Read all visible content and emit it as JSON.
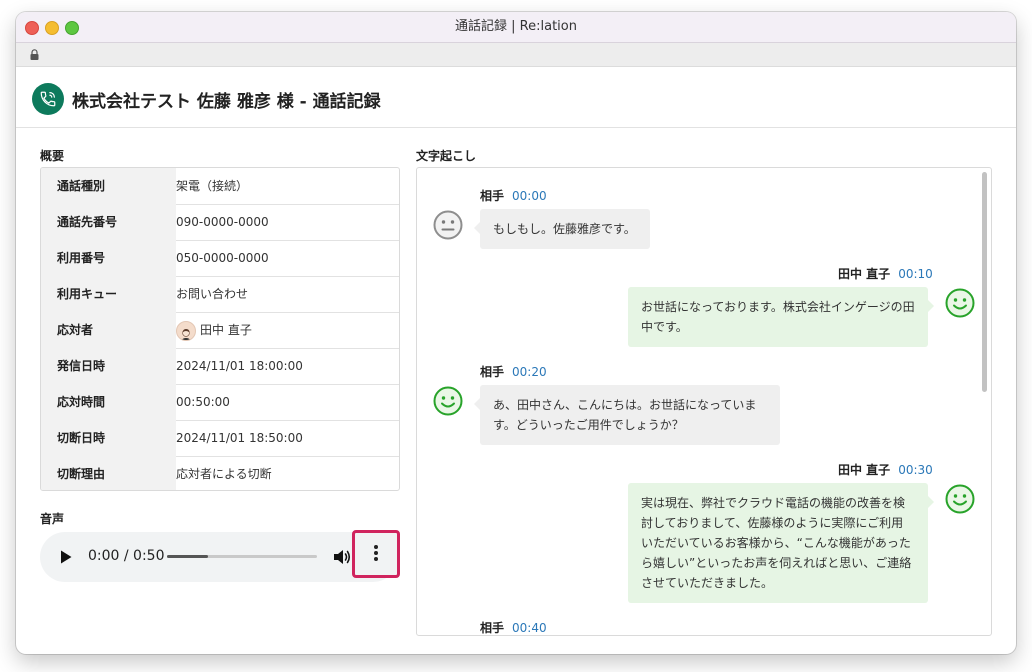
{
  "window": {
    "title": "通話記録 | Re:lation"
  },
  "header": {
    "title": "株式会社テスト  佐藤 雅彦  様 - 通話記録",
    "icon": "phone-icon",
    "accent": "#0d7a5c"
  },
  "summary": {
    "label": "概要",
    "rows": [
      {
        "key": "通話種別",
        "value": "架電（接続）"
      },
      {
        "key": "通話先番号",
        "value": "090-0000-0000"
      },
      {
        "key": "利用番号",
        "value": "050-0000-0000"
      },
      {
        "key": "利用キュー",
        "value": "お問い合わせ"
      },
      {
        "key": "応対者",
        "value": "田中 直子"
      },
      {
        "key": "発信日時",
        "value": "2024/11/01 18:00:00"
      },
      {
        "key": "応対時間",
        "value": "00:50:00"
      },
      {
        "key": "切断日時",
        "value": "2024/11/01 18:50:00"
      },
      {
        "key": "切断理由",
        "value": "応対者による切断"
      }
    ]
  },
  "audio": {
    "label": "音声",
    "time": "0:00 / 0:50",
    "progress_fraction": 0.27,
    "more_button_highlight": "#d0245e"
  },
  "transcript": {
    "label": "文字起こし",
    "messages": [
      {
        "speaker": "相手",
        "time": "00:00",
        "side": "other",
        "sentiment": "neutral-face-icon",
        "text": "もしもし。佐藤雅彦です。"
      },
      {
        "speaker": "田中 直子",
        "time": "00:10",
        "side": "me",
        "sentiment": "smile-face-icon",
        "text": "お世話になっております。株式会社インゲージの田中です。"
      },
      {
        "speaker": "相手",
        "time": "00:20",
        "side": "other",
        "sentiment": "smile-face-icon",
        "text": "あ、田中さん、こんにちは。お世話になっています。どういったご用件でしょうか？"
      },
      {
        "speaker": "田中 直子",
        "time": "00:30",
        "side": "me",
        "sentiment": "smile-face-icon",
        "text": "実は現在、弊社でクラウド電話の機能の改善を検討しておりまして、佐藤様のように実際にご利用いただいているお客様から、“こんな機能があったら嬉しい”といったお声を伺えればと思い、ご連絡させていただきました。"
      },
      {
        "speaker": "相手",
        "time": "00:40",
        "side": "other"
      }
    ]
  }
}
